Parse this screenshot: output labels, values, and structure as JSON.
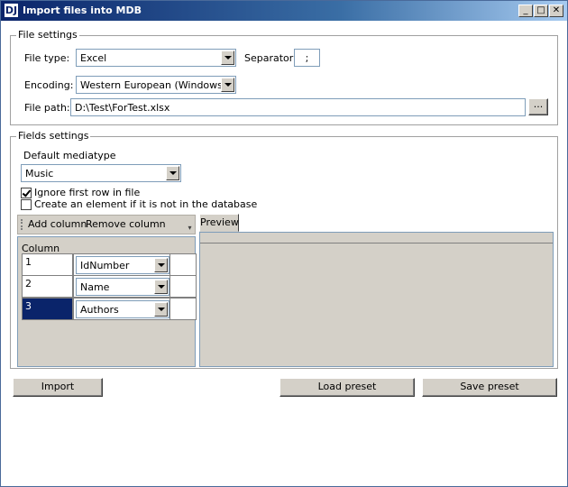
{
  "window": {
    "title": "Import files into MDB",
    "icon_label": "DJ",
    "controls": {
      "minimize": "_",
      "maximize": "□",
      "close": "✕"
    }
  },
  "file_settings": {
    "legend": "File settings",
    "file_type_label": "File type:",
    "file_type_value": "Excel",
    "separator_label": "Separator",
    "separator_value": ";",
    "encoding_label": "Encoding:",
    "encoding_value": "Western European (Windows)",
    "file_path_label": "File path:",
    "file_path_value": "D:\\Test\\ForTest.xlsx",
    "browse_label": "..."
  },
  "fields_settings": {
    "legend": "Fields settings",
    "default_mediatype_label": "Default mediatype",
    "default_mediatype_value": "Music",
    "ignore_first_row_label": "Ignore first row in file",
    "ignore_first_row_checked": true,
    "create_element_label": "Create an element if it is not in the database",
    "create_element_checked": false,
    "toolbar": {
      "add_column": "Add column",
      "remove_column": "Remove column"
    },
    "preview_tab": "Preview",
    "grid": {
      "column_header": "Column",
      "rows": [
        {
          "number": "1",
          "field": "IdNumber",
          "selected": false
        },
        {
          "number": "2",
          "field": "Name",
          "selected": false
        },
        {
          "number": "3",
          "field": "Authors",
          "selected": true
        }
      ]
    }
  },
  "buttons": {
    "import": "Import",
    "load_preset": "Load preset",
    "save_preset": "Save preset"
  },
  "colors": {
    "title_bar": "#0a246a",
    "selection": "#0a246a",
    "control_face": "#d4d0c8",
    "field_border": "#7f9db9"
  }
}
